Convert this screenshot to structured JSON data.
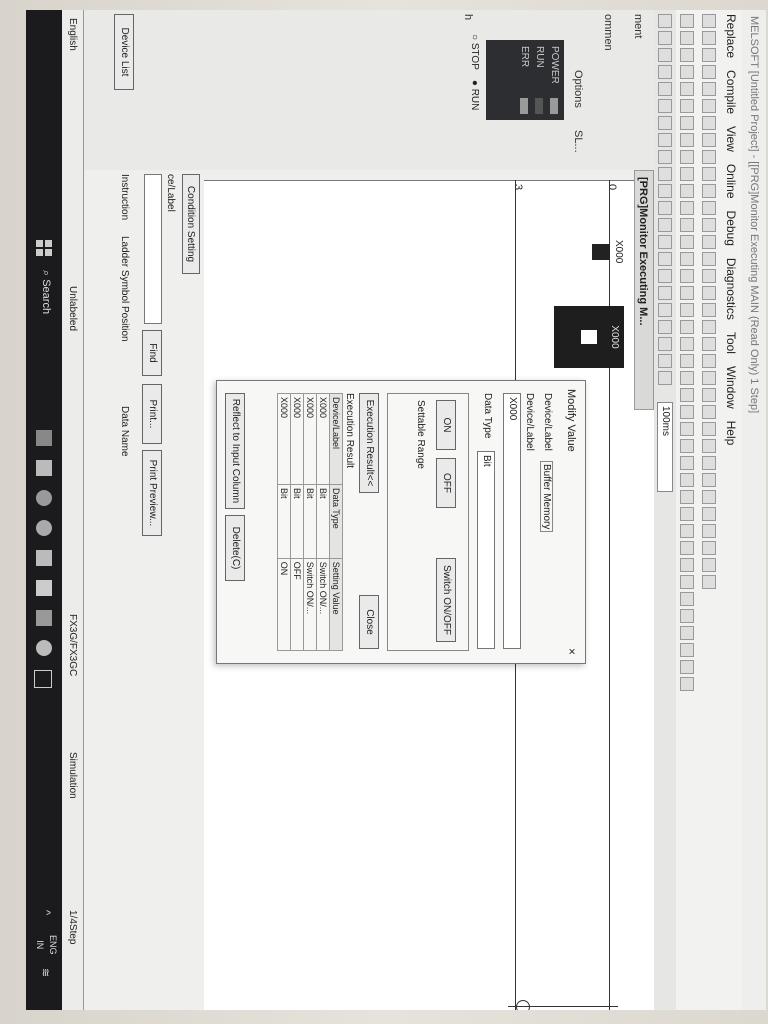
{
  "titlebar": {
    "title": "MELSOFT [Untitled Project] - [[PRG]Monitor Executing MAIN (Read Only) 1 Step]"
  },
  "menu": [
    "Replace",
    "Compile",
    "View",
    "Online",
    "Debug",
    "Diagnostics",
    "Tool",
    "Window",
    "Help"
  ],
  "toolbar": {
    "interval": "100ms"
  },
  "left_pane": {
    "labels": [
      "ment",
      "ommen",
      "SL...",
      "Options",
      "h"
    ],
    "status": {
      "power": "POWER",
      "run": "RUN",
      "err": "ERR"
    },
    "radio_stop": "STOP",
    "radio_run": "RUN",
    "device_list_tab": "Device List"
  },
  "editor": {
    "tab_label": "[PRG]Monitor Executing M...",
    "rung_numbers": [
      "0",
      "3"
    ],
    "contacts": [
      "X000",
      "X000"
    ]
  },
  "dialog": {
    "title": "Modify Value",
    "close": "×",
    "tab_device": "Device/Label",
    "tab_buffer": "Buffer Memory",
    "device_label_caption": "Device/Label",
    "device_value": "X000",
    "data_type_caption": "Data Type",
    "data_type_value": "Bit",
    "on_button": "ON",
    "off_button": "OFF",
    "switch_button": "Switch ON/OFF",
    "settable_range": "Settable Range",
    "execution_result_button": "Execution Result<<",
    "close_button": "Close",
    "execution_result_caption": "Execution Result",
    "result_columns": [
      "Device/Label",
      "Data Type",
      "Setting Value"
    ],
    "result_rows": [
      [
        "X000",
        "Bit",
        "Switch ON/..."
      ],
      [
        "X000",
        "Bit",
        "Switch ON/..."
      ],
      [
        "X000",
        "Bit",
        "OFF"
      ],
      [
        "X000",
        "Bit",
        "ON"
      ]
    ],
    "reflect_button": "Reflect to Input Column",
    "delete_button": "Delete(C)"
  },
  "find_pane": {
    "condition_tab": "Condition Setting",
    "label_caption": "ce/Label",
    "find_button": "Find",
    "print_button": "Print...",
    "print_preview_button": "Print Preview...",
    "columns": [
      "Instruction",
      "Ladder Symbol",
      "Position",
      "Data Name"
    ]
  },
  "statusbar": {
    "language": "English",
    "labeled": "Unlabeled",
    "cpu": "FX3G/FX3GC",
    "mode": "Simulation",
    "steps": "1/4Step"
  },
  "taskbar": {
    "search": "Search",
    "lang_top": "ENG",
    "lang_bottom": "IN"
  }
}
